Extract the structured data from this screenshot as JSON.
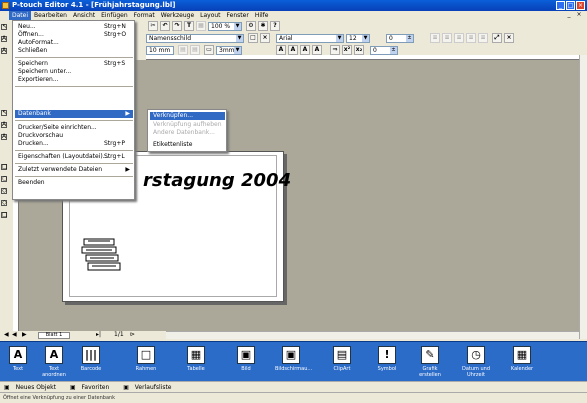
{
  "window": {
    "title": "P-touch Editor 4.1 - [Frühjahrstagung.lbl]"
  },
  "menubar": [
    "Datei",
    "Bearbeiten",
    "Ansicht",
    "Einfügen",
    "Format",
    "Werkzeuge",
    "Layout",
    "Fenster",
    "Hilfe"
  ],
  "toolbar": {
    "zoom": "100 %",
    "layout_name": "Namensschild",
    "font": "Arial",
    "font_size": "12",
    "spacing": "0",
    "tape_width": "3mm",
    "margin": "10 mm",
    "tape_size": "62mmx100mm",
    "line_spacing": "0"
  },
  "file_menu": {
    "items": [
      {
        "label": "Neu...",
        "shortcut": "Strg+N"
      },
      {
        "label": "Öffnen...",
        "shortcut": "Strg+O"
      },
      {
        "label": "AutoFormat...",
        "shortcut": ""
      },
      {
        "label": "Schließen",
        "shortcut": ""
      },
      {
        "label": "Speichern",
        "shortcut": "Strg+S"
      },
      {
        "label": "Speichern unter...",
        "shortcut": ""
      },
      {
        "label": "Exportieren...",
        "shortcut": ""
      },
      {
        "label": "Datenbank",
        "shortcut": ""
      },
      {
        "label": "Drucker/Seite einrichten...",
        "shortcut": ""
      },
      {
        "label": "Druckvorschau",
        "shortcut": ""
      },
      {
        "label": "Drucken...",
        "shortcut": "Strg+P"
      },
      {
        "label": "Eigenschaften (Layoutdatei)...",
        "shortcut": "Strg+L"
      },
      {
        "label": "Zuletzt verwendete Dateien",
        "shortcut": ""
      },
      {
        "label": "Beenden",
        "shortcut": ""
      }
    ]
  },
  "database_submenu": {
    "items": [
      "Verknüpfen...",
      "Verknüpfung aufheben",
      "Andere Datenbank...",
      "Etikettenliste"
    ]
  },
  "canvas": {
    "label_text": "rstagung 2004"
  },
  "sheet": {
    "tab": "Blatt 1",
    "page_indicator": "1/1"
  },
  "palette": {
    "items": [
      "Text",
      "Text anordnen",
      "Barcode",
      "Rahmen",
      "Tabelle",
      "Bild",
      "Bildschirmau...",
      "ClipArt",
      "Symbol",
      "Grafik erstellen",
      "Datum und Uhrzeit",
      "Kalender"
    ]
  },
  "bottom_tabs": [
    "Neues Objekt",
    "Favoriten",
    "Verlaufsliste"
  ],
  "status": {
    "text": "Öffnet eine Verknüpfung zu einer Datenbank"
  },
  "colors": {
    "titlebar": "#0a5fd8",
    "palette": "#2c6cc9",
    "highlight": "#316ac5"
  }
}
